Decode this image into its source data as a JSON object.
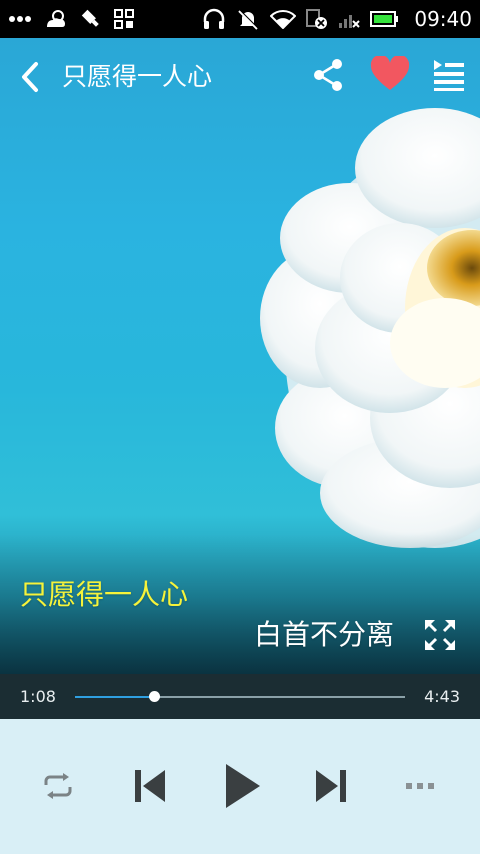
{
  "status_bar": {
    "time": "09:40",
    "icons": [
      "more-dots-icon",
      "weather-icon",
      "usb-icon",
      "apps-icon",
      "headphones-icon",
      "mute-icon",
      "wifi-icon",
      "sim-icon",
      "signal-icon",
      "battery-icon"
    ],
    "battery_color": "#35e23c"
  },
  "header": {
    "title": "只愿得一人心",
    "icons": [
      "back-icon",
      "share-icon",
      "heart-icon",
      "playlist-icon"
    ],
    "heart_color": "#f25760"
  },
  "lyrics": {
    "current": "只愿得一人心",
    "next": "白首不分离",
    "current_color": "#f6f33a"
  },
  "progress": {
    "current_time": "1:08",
    "total_time": "4:43",
    "fraction": 0.24,
    "fill_color": "#2f9fe0"
  },
  "controls": {
    "icons": [
      "repeat-icon",
      "previous-icon",
      "play-icon",
      "next-icon",
      "more-icon"
    ]
  }
}
